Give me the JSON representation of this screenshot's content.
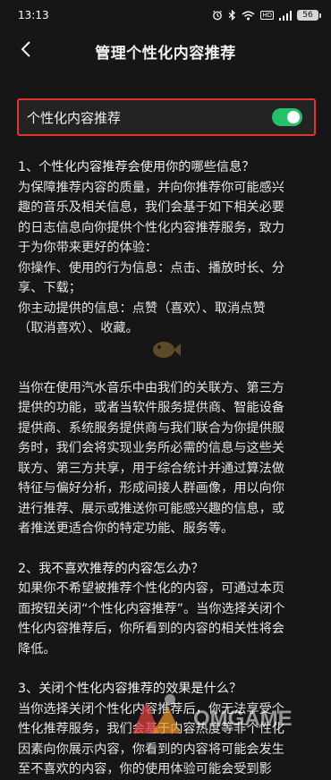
{
  "status_bar": {
    "time": "13:13",
    "battery": "56",
    "network": "HD",
    "icons": [
      "alarm-icon",
      "bluetooth-icon",
      "wifi-icon",
      "hd-icon",
      "signal-icon",
      "battery-icon"
    ]
  },
  "header": {
    "title": "管理个性化内容推荐",
    "back_icon": "chevron-left-icon"
  },
  "toggle_setting": {
    "label": "个性化内容推荐",
    "enabled": true,
    "accent_color": "#24c16b",
    "highlight_color": "#e23232"
  },
  "sections": {
    "s1": {
      "title": "1、个性化内容推荐会使用你的哪些信息？",
      "intro": [
        "为保障推荐内容的质量，并向你推荐你可能感兴",
        "趣的音乐及相关信息，我们会基于如下相关必要",
        "的日志信息向你提供个性化内容推荐服务，致力",
        "于为你带来更好的体验："
      ],
      "items": [
        "你操作、使用的行为信息：点击、播放时长、分",
        "享、下载；",
        "你主动提供的信息：点赞（喜欢）、取消点赞",
        "（取消喜欢）、收藏。"
      ],
      "paragraph2": [
        "当你在使用汽水音乐中由我们的关联方、第三方",
        "提供的功能，或者当软件服务提供商、智能设备",
        "提供商、系统服务提供商与我们联合为你提供服",
        "务时，我们会将实现业务所必需的信息与这些关",
        "联方、第三方共享，用于综合统计并通过算法做",
        "特征与偏好分析，形成间接人群画像，用以向你",
        "进行推荐、展示或推送你可能感兴趣的信息，或",
        "者推送更适合你的特定功能、服务等。"
      ]
    },
    "s2": {
      "title": "2、我不喜欢推荐的内容怎么办？",
      "body": [
        "如果你不希望被推荐个性化的内容，可通过本页",
        "面按钮关闭“个性化内容推荐”。当你选择关闭个",
        "性化内容推荐后，你所看到的内容的相关性将会",
        "降低。"
      ]
    },
    "s3": {
      "title": "3、关闭个性化内容推荐的效果是什么？",
      "body": [
        "当你选择关闭个性化内容推荐后，你无法享受个",
        "性化推荐服务，我们会基于内容热度等非个性化",
        "因素向你展示内容，你看到的内容将可能会发生",
        "至不喜欢的内容，你的使用体验可能会受到影"
      ]
    }
  },
  "watermark": {
    "text": "OMGAME"
  }
}
